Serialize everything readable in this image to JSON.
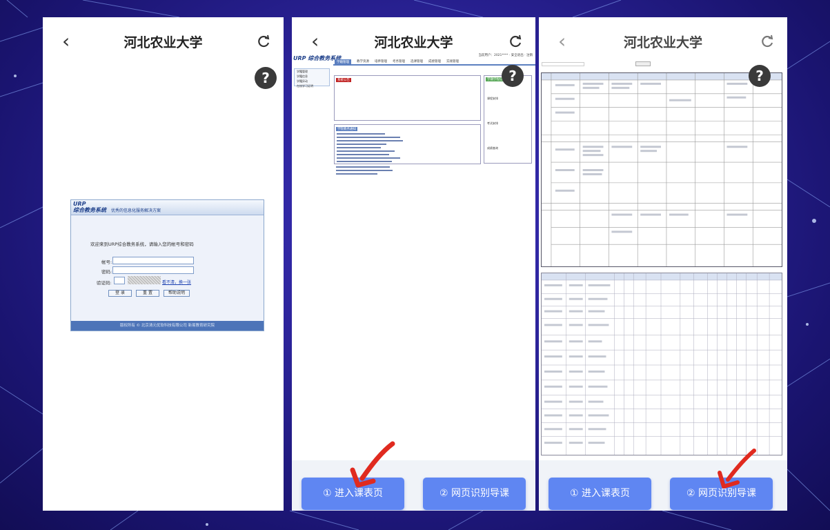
{
  "panels": [
    {
      "back_icon": "back-chevron-icon",
      "title": "河北农业大学",
      "refresh_icon": "refresh-icon",
      "help_label": "?",
      "login": {
        "logo_line1": "URP",
        "logo_line2": "综合教务系统",
        "subtitle": "优秀的信息化服务解决方案",
        "welcome": "欢迎来到URP综合教务系统，请输入您的帐号和密码",
        "account_label": "帐号:",
        "password_label": "密码:",
        "captcha_label": "验证码:",
        "captcha_refresh": "看不清，换一张",
        "login_button": "登 录",
        "reset_button": "重 置",
        "help_button": "帮助说明",
        "footer": "版权所有 © 北京清元优软科技有限公司 新易教育研究院"
      }
    },
    {
      "back_icon": "back-chevron-icon",
      "title": "河北农业大学",
      "refresh_icon": "refresh-icon",
      "help_label": "?",
      "urp": {
        "brand": "URP 综合教务系统",
        "user": "当前用户：2021****  ·  安全退出  ·  注销",
        "tabs": [
          "学籍管理",
          "教学资源",
          "培养管理",
          "考务管理",
          "选课管理",
          "成绩管理",
          "实践管理"
        ],
        "side_items": [
          "学籍管理",
          "学籍信息",
          "学籍异动",
          "在校学习证明"
        ],
        "notice_title": "系统公告",
        "notice_list_title": "学院教务通知",
        "right_title": "学期学程信息",
        "right_items": [
          "课程安排",
          "考试安排",
          "成绩查询"
        ]
      }
    },
    {
      "back_icon": "back-chevron-icon",
      "title": "河北农业大学",
      "refresh_icon": "refresh-icon",
      "help_label": "?"
    }
  ],
  "buttons": {
    "enter_timetable": "① 进入课表页",
    "web_import": "② 网页识别导课"
  },
  "colors": {
    "primary_button": "#5f86f2",
    "arrow_red": "#e02a1f",
    "background": "#2a2296"
  }
}
